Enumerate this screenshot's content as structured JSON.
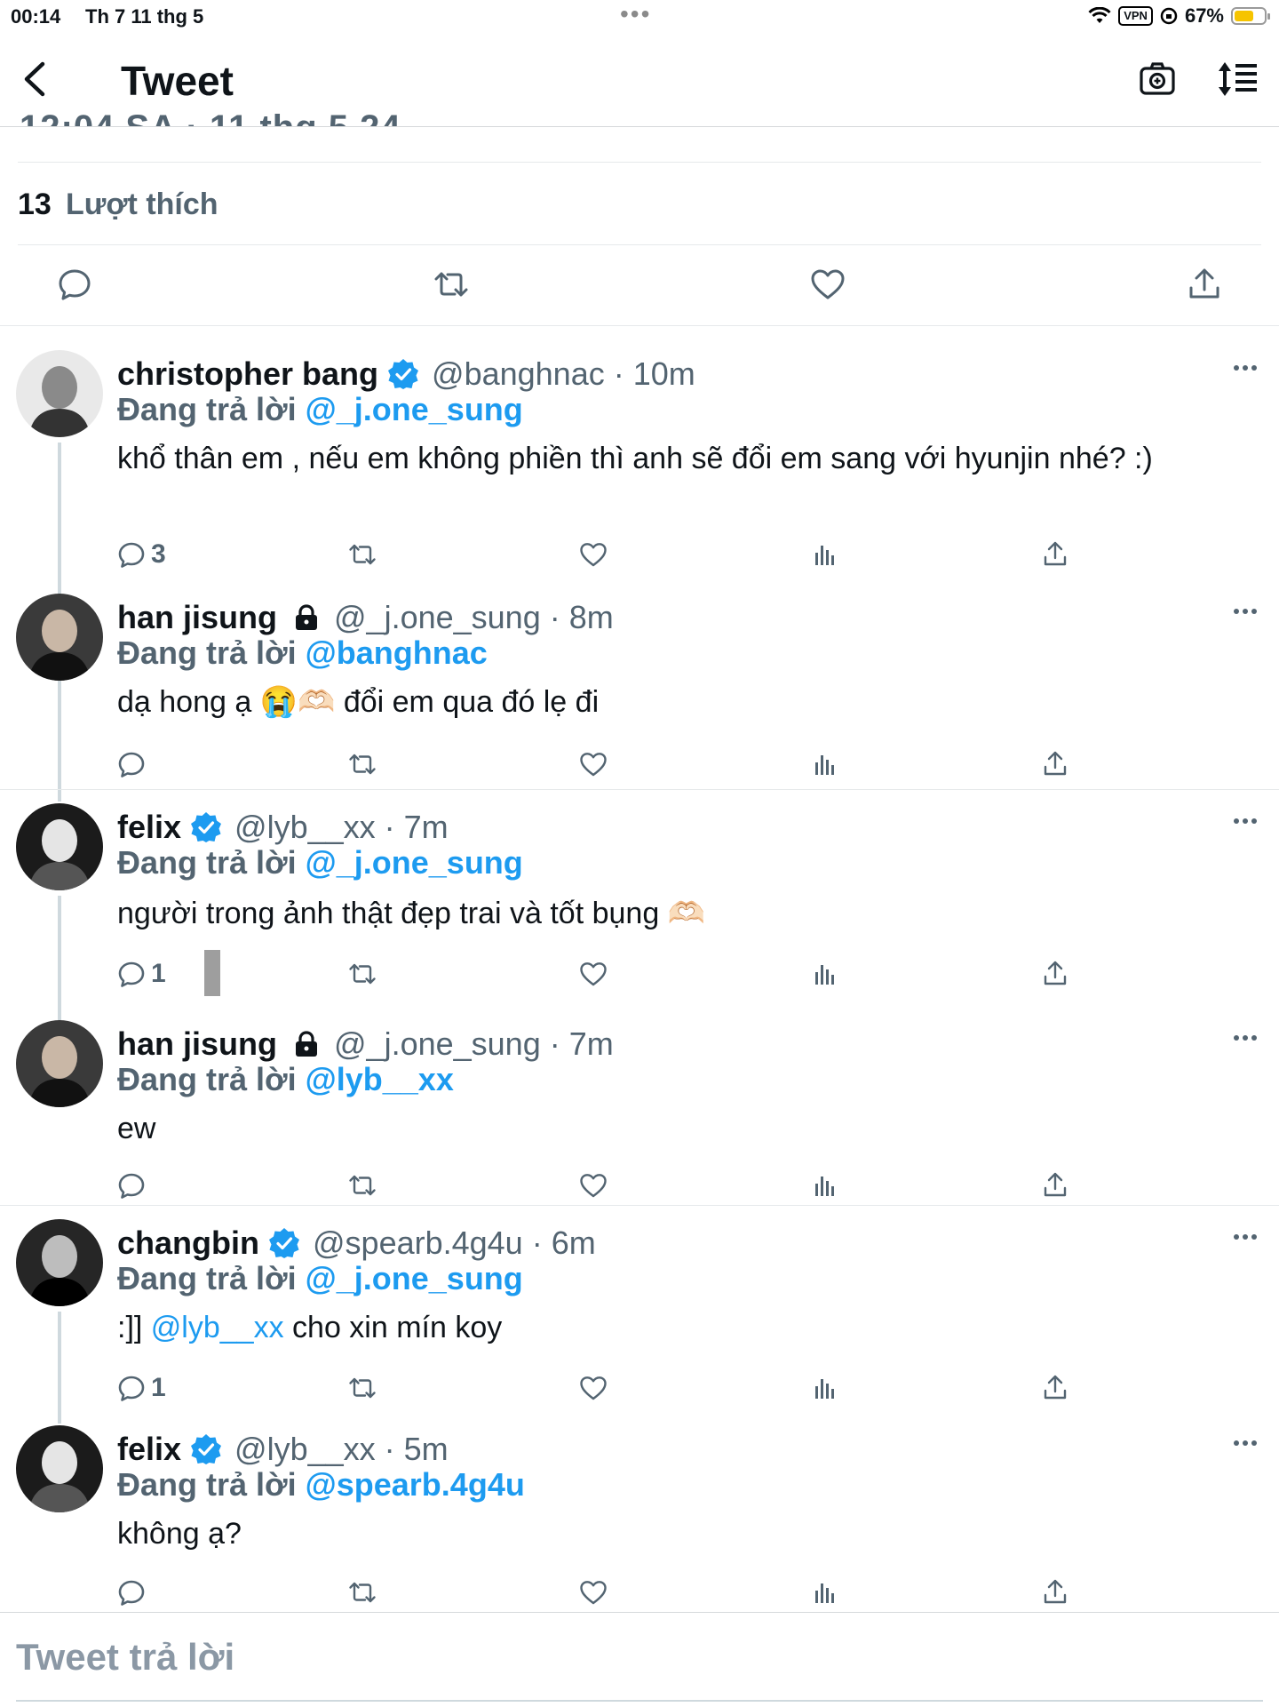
{
  "status_bar": {
    "time": "00:14",
    "date": "Th 7 11 thg 5",
    "vpn": "VPN",
    "battery": "67%",
    "battery_level": 0.67
  },
  "header": {
    "title": "Tweet"
  },
  "main_tweet": {
    "timestamp_partial": "12:04 SA · 11 thg 5 24",
    "likes_count": "13",
    "likes_label": "Lượt thích"
  },
  "reply_to_label": "Đang trả lời",
  "replies": [
    {
      "name": "christopher bang",
      "verified": true,
      "locked": false,
      "handle": "@banghnac",
      "time": "· 10m",
      "replying_to": "@_j.one_sung",
      "text": "khổ thân em , nếu em không phiền thì anh sẽ đổi em sang với hyunjin nhé? :)",
      "reply_count": "3"
    },
    {
      "name": "han jisung",
      "verified": false,
      "locked": true,
      "handle": "@_j.one_sung",
      "time": "· 8m",
      "replying_to": "@banghnac",
      "text": "dạ hong ạ 😭🫶🏻 đổi em qua đó lẹ đi",
      "reply_count": ""
    },
    {
      "name": "felix",
      "verified": true,
      "locked": false,
      "handle": "@lyb__xx",
      "time": "· 7m",
      "replying_to": "@_j.one_sung",
      "text": "người trong ảnh thật đẹp trai và tốt bụng 🫶🏻",
      "reply_count": "1"
    },
    {
      "name": "han jisung",
      "verified": false,
      "locked": true,
      "handle": "@_j.one_sung",
      "time": "· 7m",
      "replying_to": "@lyb__xx",
      "text": "ew",
      "reply_count": ""
    },
    {
      "name": "changbin",
      "verified": true,
      "locked": false,
      "handle": "@spearb.4g4u",
      "time": "· 6m",
      "replying_to": "@_j.one_sung",
      "text_prefix": ":]] ",
      "text_mention": "@lyb__xx",
      "text_suffix": " cho xin mín koy",
      "reply_count": "1"
    },
    {
      "name": "felix",
      "verified": true,
      "locked": false,
      "handle": "@lyb__xx",
      "time": "· 5m",
      "replying_to": "@spearb.4g4u",
      "text": "không ạ?",
      "reply_count": ""
    }
  ],
  "composer": {
    "placeholder": "Tweet trả lời"
  },
  "colors": {
    "accent": "#1d9bf0",
    "secondary_text": "#536471",
    "primary_text": "#0f1419",
    "divider": "#e6e9eb",
    "battery": "#f6c400"
  },
  "icons": [
    "back-icon",
    "camera-icon",
    "sort-icon",
    "reply-icon",
    "retweet-icon",
    "like-icon",
    "share-icon",
    "views-icon",
    "more-icon",
    "verified-icon",
    "lock-icon"
  ]
}
